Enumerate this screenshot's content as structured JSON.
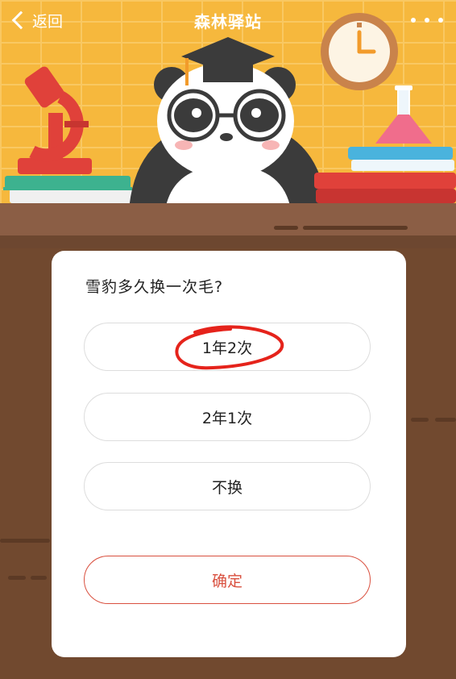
{
  "nav": {
    "back_label": "返回",
    "title": "森林驿站"
  },
  "quiz": {
    "question": "雪豹多久换一次毛?",
    "options": [
      {
        "label": "1年2次",
        "circled": true
      },
      {
        "label": "2年1次",
        "circled": false
      },
      {
        "label": "不换",
        "circled": false
      }
    ],
    "confirm_label": "确定"
  },
  "colors": {
    "scene_background": "#f6b83d",
    "wood": "#71492f",
    "accent": "#d9503f",
    "annotation": "#e5231b"
  }
}
